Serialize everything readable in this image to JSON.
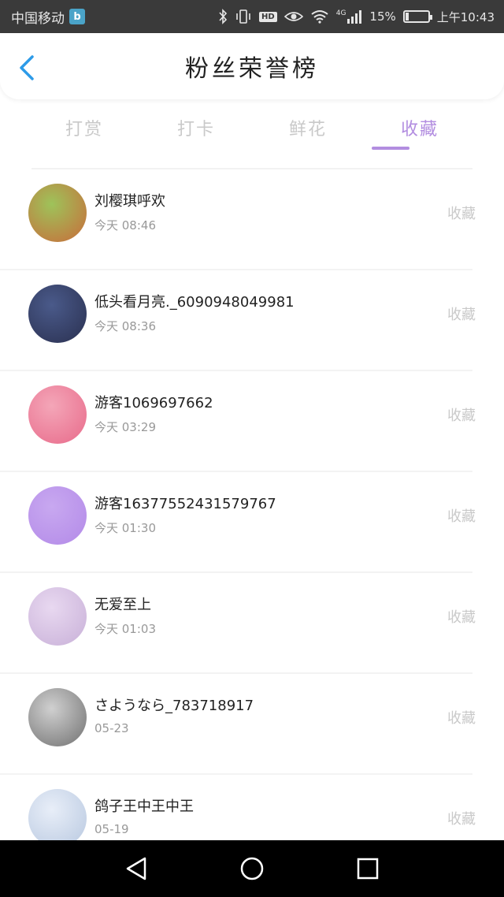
{
  "status_bar": {
    "carrier": "中国移动",
    "carrier_badge": "b",
    "network": "4G",
    "battery_percent": "15%",
    "battery_level": 0.15,
    "time": "上午10:43",
    "hd_label": "HD"
  },
  "header": {
    "title": "粉丝荣誉榜"
  },
  "tabs": [
    {
      "label": "打赏",
      "active": false
    },
    {
      "label": "打卡",
      "active": false
    },
    {
      "label": "鲜花",
      "active": false
    },
    {
      "label": "收藏",
      "active": true
    }
  ],
  "list": [
    {
      "name": "刘樱琪呼欢",
      "time": "今天 08:46",
      "action": "收藏",
      "avatar_colors": [
        "#9ec35a",
        "#c96b3a"
      ]
    },
    {
      "name": "低头看月亮._6090948049981",
      "time": "今天 08:36",
      "action": "收藏",
      "avatar_colors": [
        "#4a5a8a",
        "#2a3050"
      ]
    },
    {
      "name": "游客1069697662",
      "time": "今天 03:29",
      "action": "收藏",
      "avatar_colors": [
        "#f4a6b8",
        "#e86a8a"
      ]
    },
    {
      "name": "游客16377552431579767",
      "time": "今天 01:30",
      "action": "收藏",
      "avatar_colors": [
        "#c8a8f0",
        "#b38ae8"
      ]
    },
    {
      "name": "无爱至上",
      "time": "今天 01:03",
      "action": "收藏",
      "avatar_colors": [
        "#e8d8f0",
        "#c8b0d8"
      ]
    },
    {
      "name": "さようなら_783718917",
      "time": "05-23",
      "action": "收藏",
      "avatar_colors": [
        "#d0d0d0",
        "#707070"
      ]
    },
    {
      "name": "鸽子王中王中王",
      "time": "05-19",
      "action": "收藏",
      "avatar_colors": [
        "#e8eef8",
        "#b8c8e0"
      ]
    }
  ],
  "colors": {
    "accent": "#b28de0",
    "inactive_tab": "#c9c9c9"
  }
}
